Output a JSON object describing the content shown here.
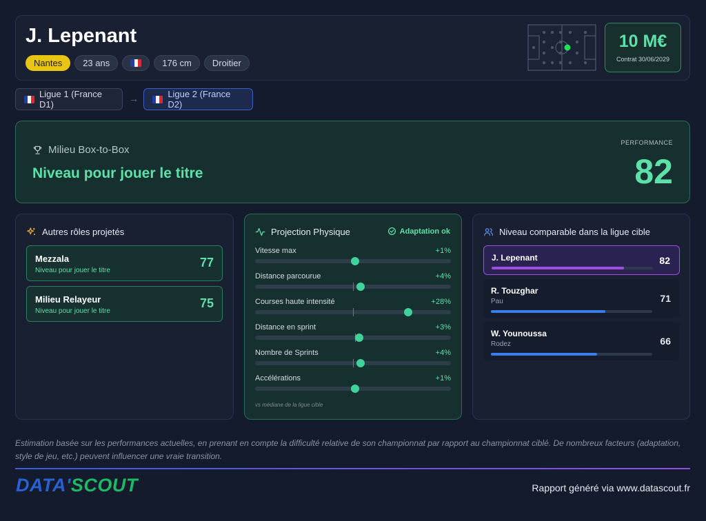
{
  "player": {
    "name": "J. Lepenant",
    "club": "Nantes",
    "age": "23 ans",
    "nationality_flag": "france-flag",
    "height": "176 cm",
    "foot": "Droitier",
    "market_value": "10 M€",
    "contract": "Contrat 30/06/2029"
  },
  "leagues": {
    "from": "Ligue 1 (France D1)",
    "to": "Ligue 2 (France D2)",
    "arrow": "→"
  },
  "main_role": {
    "icon": "trophy-icon",
    "role": "Milieu Box-to-Box",
    "level": "Niveau pour jouer le titre",
    "performance_label": "PERFORMANCE",
    "performance_value": "82"
  },
  "other_roles": {
    "title": "Autres rôles projetés",
    "icon": "sparkles-icon",
    "items": [
      {
        "name": "Mezzala",
        "level": "Niveau pour jouer le titre",
        "score": "77"
      },
      {
        "name": "Milieu Relayeur",
        "level": "Niveau pour jouer le titre",
        "score": "75"
      }
    ]
  },
  "physique": {
    "title": "Projection Physique",
    "icon": "activity-icon",
    "status": "Adaptation ok",
    "note": "vs médiane de la ligue cible",
    "metrics": [
      {
        "label": "Vitesse max",
        "delta": "+1%",
        "value_pct": 51,
        "median_pct": 51
      },
      {
        "label": "Distance parcourue",
        "delta": "+4%",
        "value_pct": 54,
        "median_pct": 50
      },
      {
        "label": "Courses haute intensité",
        "delta": "+28%",
        "value_pct": 78,
        "median_pct": 50
      },
      {
        "label": "Distance en sprint",
        "delta": "+3%",
        "value_pct": 53,
        "median_pct": 51
      },
      {
        "label": "Nombre de Sprints",
        "delta": "+4%",
        "value_pct": 54,
        "median_pct": 50
      },
      {
        "label": "Accélérations",
        "delta": "+1%",
        "value_pct": 51,
        "median_pct": 51
      }
    ]
  },
  "comparison": {
    "title": "Niveau comparable dans la ligue cible",
    "icon": "users-icon",
    "players": [
      {
        "name": "J. Lepenant",
        "club": "",
        "score": "82",
        "bar_pct": 82,
        "color": "#a24ce6",
        "highlight": true
      },
      {
        "name": "R. Touzghar",
        "club": "Pau",
        "score": "71",
        "bar_pct": 71,
        "color": "#3a7de8",
        "highlight": false
      },
      {
        "name": "W. Younoussa",
        "club": "Rodez",
        "score": "66",
        "bar_pct": 66,
        "color": "#3a7de8",
        "highlight": false
      }
    ]
  },
  "footer": {
    "disclaimer": "Estimation basée sur les performances actuelles, en prenant en compte la difficulté relative de son championnat par rapport au championnat ciblé. De nombreux facteurs (adaptation, style de jeu, etc.) peuvent influencer une vraie transition.",
    "logo_part1": "DATA'",
    "logo_part2": "SCOUT",
    "credit": "Rapport généré via www.datascout.fr"
  },
  "colors": {
    "accent_green": "#5fe0a8",
    "club_yellow": "#e8c513",
    "compare_purple": "#a24ce6",
    "compare_blue": "#3a7de8"
  }
}
